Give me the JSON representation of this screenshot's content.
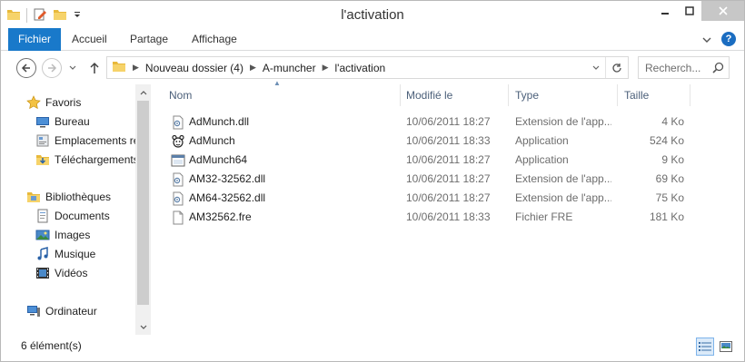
{
  "window": {
    "title": "l'activation"
  },
  "ribbon": {
    "tabs": [
      "Fichier",
      "Accueil",
      "Partage",
      "Affichage"
    ],
    "help": "?"
  },
  "address": {
    "crumbs": [
      "Nouveau dossier (4)",
      "A-muncher",
      "l'activation"
    ]
  },
  "search": {
    "placeholder": "Recherch..."
  },
  "nav": {
    "items": [
      {
        "label": "Favoris",
        "icon": "star-icon"
      },
      {
        "label": "Bureau",
        "icon": "desktop-icon"
      },
      {
        "label": "Emplacements ré",
        "icon": "recent-places-icon"
      },
      {
        "label": "Téléchargements",
        "icon": "downloads-icon"
      },
      {
        "label": "Bibliothèques",
        "icon": "libraries-icon"
      },
      {
        "label": "Documents",
        "icon": "documents-icon"
      },
      {
        "label": "Images",
        "icon": "pictures-icon"
      },
      {
        "label": "Musique",
        "icon": "music-icon"
      },
      {
        "label": "Vidéos",
        "icon": "videos-icon"
      },
      {
        "label": "Ordinateur",
        "icon": "computer-icon"
      }
    ]
  },
  "columns": {
    "name": "Nom",
    "modified": "Modifié le",
    "type": "Type",
    "size": "Taille"
  },
  "files": [
    {
      "name": "AdMunch.dll",
      "modified": "10/06/2011 18:27",
      "type": "Extension de l'app...",
      "size": "4 Ko",
      "icon": "dll-icon"
    },
    {
      "name": "AdMunch",
      "modified": "10/06/2011 18:33",
      "type": "Application",
      "size": "524 Ko",
      "icon": "admunch-app-icon"
    },
    {
      "name": "AdMunch64",
      "modified": "10/06/2011 18:27",
      "type": "Application",
      "size": "9 Ko",
      "icon": "application-icon"
    },
    {
      "name": "AM32-32562.dll",
      "modified": "10/06/2011 18:27",
      "type": "Extension de l'app...",
      "size": "69 Ko",
      "icon": "dll-icon"
    },
    {
      "name": "AM64-32562.dll",
      "modified": "10/06/2011 18:27",
      "type": "Extension de l'app...",
      "size": "75 Ko",
      "icon": "dll-icon"
    },
    {
      "name": "AM32562.fre",
      "modified": "10/06/2011 18:33",
      "type": "Fichier FRE",
      "size": "181 Ko",
      "icon": "file-icon"
    }
  ],
  "status": {
    "count": "6 élément(s)"
  }
}
